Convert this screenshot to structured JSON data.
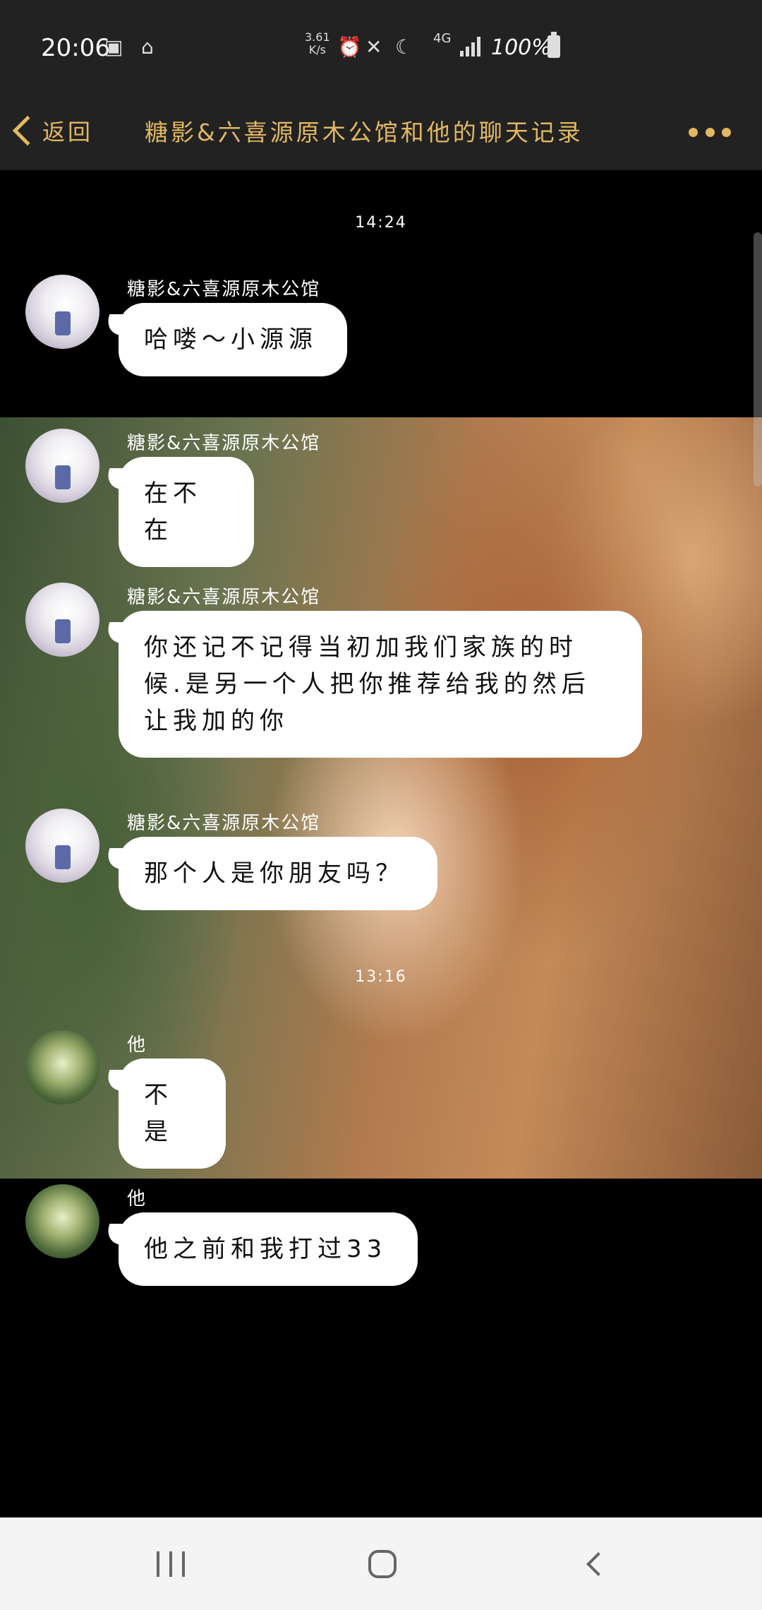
{
  "status_bar": {
    "time": "20:06",
    "net_speed_value": "3.61",
    "net_speed_unit": "K/s",
    "network": "4G",
    "battery": "100%",
    "icons": [
      "image-icon",
      "bag-icon",
      "alarm-icon",
      "mute-icon",
      "moon-icon",
      "signal-icon",
      "battery-icon"
    ]
  },
  "header": {
    "back_label": "返回",
    "title": "糖影&六喜源原木公馆和他的聊天记录"
  },
  "chat": {
    "timestamps": [
      "14:24",
      "13:16"
    ],
    "messages": [
      {
        "sender": "糖影&六喜源原木公馆",
        "text": "哈喽～小源源"
      },
      {
        "sender": "糖影&六喜源原木公馆",
        "text": "在不在"
      },
      {
        "sender": "糖影&六喜源原木公馆",
        "text": "你还记不记得当初加我们家族的时候.是另一个人把你推荐给我的然后让我加的你"
      },
      {
        "sender": "糖影&六喜源原木公馆",
        "text": "那个人是你朋友吗？"
      },
      {
        "sender": "他",
        "text": "不是"
      },
      {
        "sender": "他",
        "text": "他之前和我打过33"
      }
    ]
  },
  "colors": {
    "accent": "#e2b860",
    "bar_bg": "#222222",
    "chat_bg": "#000000",
    "bubble_bg": "#ffffff"
  }
}
